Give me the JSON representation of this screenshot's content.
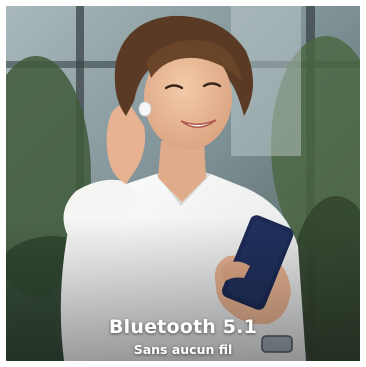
{
  "photo": {
    "scene": "woman-with-wireless-earbud-holding-smartphone",
    "palette": {
      "background_glass": "#8fa3a8",
      "foliage": "#3f5a3a",
      "shirt": "#f3f3f1",
      "skin": "#e9b99b",
      "hair": "#5a3a24",
      "phone": "#1c2a55",
      "caption_text": "#ffffff"
    }
  },
  "caption": {
    "headline": "Bluetooth 5.1",
    "subline": "Sans aucun fil"
  }
}
